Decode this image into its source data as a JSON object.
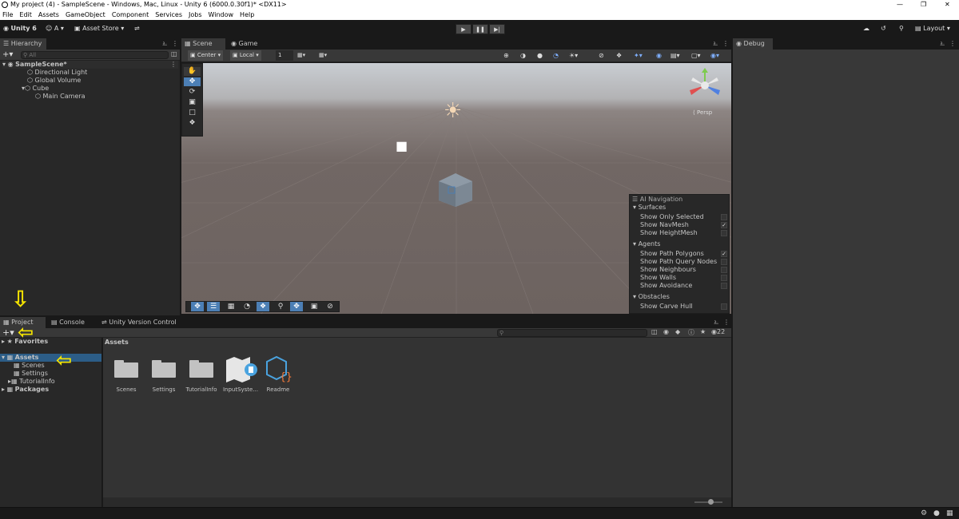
{
  "window": {
    "title": "My project (4) - SampleScene - Windows, Mac, Linux - Unity 6 (6000.0.30f1)* <DX11>"
  },
  "menu": [
    "File",
    "Edit",
    "Assets",
    "GameObject",
    "Component",
    "Services",
    "Jobs",
    "Window",
    "Help"
  ],
  "toolbar": {
    "account": "Unity 6",
    "user": "A",
    "asset_store": "Asset Store",
    "layout": "Layout"
  },
  "hierarchy": {
    "tab": "Hierarchy",
    "search_placeholder": "All",
    "scene": "SampleScene*",
    "items": [
      "Directional Light",
      "Global Volume",
      "Cube",
      "Main Camera"
    ]
  },
  "scene_view": {
    "tabs": [
      "Scene",
      "Game"
    ],
    "pivot": "Center",
    "space": "Local",
    "grid_value": "1",
    "persp": "Persp"
  },
  "ai_nav": {
    "title": "AI Navigation",
    "surfaces": {
      "label": "Surfaces",
      "items": [
        {
          "label": "Show Only Selected",
          "checked": false
        },
        {
          "label": "Show NavMesh",
          "checked": true
        },
        {
          "label": "Show HeightMesh",
          "checked": false
        }
      ]
    },
    "agents": {
      "label": "Agents",
      "items": [
        {
          "label": "Show Path Polygons",
          "checked": true
        },
        {
          "label": "Show Path Query Nodes",
          "checked": false
        },
        {
          "label": "Show Neighbours",
          "checked": false
        },
        {
          "label": "Show Walls",
          "checked": false
        },
        {
          "label": "Show Avoidance",
          "checked": false
        }
      ]
    },
    "obstacles": {
      "label": "Obstacles",
      "items": [
        {
          "label": "Show Carve Hull",
          "checked": false
        }
      ]
    }
  },
  "debug": {
    "tab": "Debug"
  },
  "bottom": {
    "tabs": [
      "Project",
      "Console",
      "Unity Version Control"
    ],
    "hidden_count": "22",
    "favorites": "Favorites",
    "tree": [
      "Assets",
      "Scenes",
      "Settings",
      "TutorialInfo",
      "Packages"
    ],
    "breadcrumb": "Assets",
    "assets": [
      "Scenes",
      "Settings",
      "TutorialInfo",
      "InputSyste...",
      "Readme"
    ]
  },
  "colors": {
    "accent": "#4c7fb5",
    "highlight_arrow": "#f5e400",
    "scene_ground": "#706663",
    "scene_sky": "#c8cdd3"
  }
}
